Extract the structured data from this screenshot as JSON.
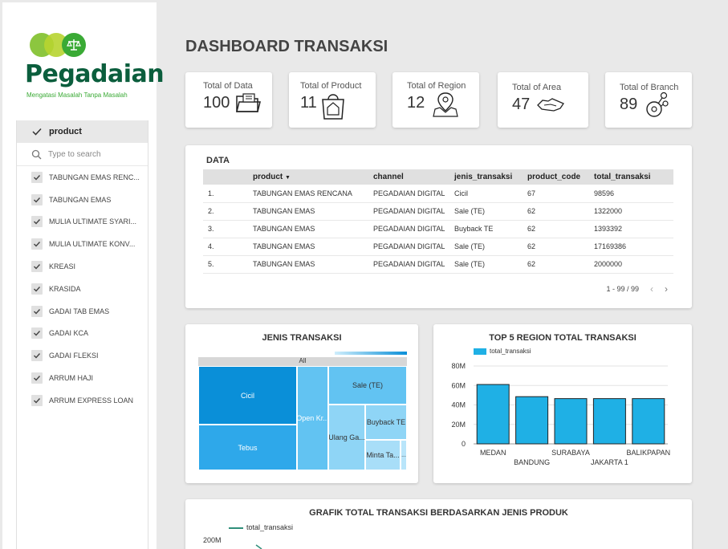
{
  "brand": {
    "name": "Pegadaian",
    "tagline": "Mengatasi Masalah Tanpa Masalah",
    "colors": {
      "dark_green": "#0b5e3d",
      "green": "#3aaa35",
      "light_green": "#8cc63f"
    }
  },
  "filter": {
    "header": "product",
    "search_placeholder": "Type to search",
    "options": [
      "TABUNGAN EMAS RENCANA",
      "TABUNGAN EMAS",
      "MULIA ULTIMATE SYARIAH",
      "MULIA ULTIMATE KONVENSIONAL",
      "KREASI",
      "KRASIDA",
      "GADAI TAB EMAS",
      "GADAI KCA",
      "GADAI FLEKSI",
      "ARRUM HAJI",
      "ARRUM EXPRESS LOAN"
    ],
    "options_display": [
      "TABUNGAN EMAS RENC...",
      "TABUNGAN EMAS",
      "MULIA ULTIMATE SYARI...",
      "MULIA ULTIMATE KONV...",
      "KREASI",
      "KRASIDA",
      "GADAI TAB EMAS",
      "GADAI KCA",
      "GADAI FLEKSI",
      "ARRUM HAJI",
      "ARRUM EXPRESS LOAN"
    ]
  },
  "page_title": "DASHBOARD TRANSAKSI",
  "kpis": [
    {
      "label": "Total of Data",
      "value": "100",
      "icon": "folder-icon"
    },
    {
      "label": "Total of Product",
      "value": "11",
      "icon": "shopping-bag-icon"
    },
    {
      "label": "Total of Region",
      "value": "12",
      "icon": "map-pin-icon"
    },
    {
      "label": "Total of Area",
      "value": "47",
      "icon": "area-map-icon"
    },
    {
      "label": "Total of Branch",
      "value": "89",
      "icon": "branch-icon"
    }
  ],
  "data_table": {
    "title": "DATA",
    "columns": [
      "",
      "product",
      "channel",
      "jenis_transaksi",
      "product_code",
      "total_transaksi"
    ],
    "sort_column": "product",
    "rows": [
      [
        "1.",
        "TABUNGAN EMAS RENCANA",
        "PEGADAIAN DIGITAL",
        "Cicil",
        "67",
        "98596"
      ],
      [
        "2.",
        "TABUNGAN EMAS",
        "PEGADAIAN DIGITAL",
        "Sale (TE)",
        "62",
        "1322000"
      ],
      [
        "3.",
        "TABUNGAN EMAS",
        "PEGADAIAN DIGITAL",
        "Buyback TE",
        "62",
        "1393392"
      ],
      [
        "4.",
        "TABUNGAN EMAS",
        "PEGADAIAN DIGITAL",
        "Sale (TE)",
        "62",
        "17169386"
      ],
      [
        "5.",
        "TABUNGAN EMAS",
        "PEGADAIAN DIGITAL",
        "Sale (TE)",
        "62",
        "2000000"
      ]
    ],
    "pagination": "1 - 99 / 99"
  },
  "treemap": {
    "title": "JENIS TRANSAKSI",
    "root_label": "All",
    "cells": [
      "Cicil",
      "Tebus",
      "Open Kr...",
      "Sale (TE)",
      "Ulang Ga...",
      "Buyback TE",
      "Minta Ta...",
      "..."
    ],
    "colors": {
      "dark": "#0a8fd8",
      "mid": "#2ea8ea",
      "light": "#62c3f2",
      "lighter": "#8fd5f6"
    }
  },
  "chart_data": [
    {
      "type": "bar",
      "title": "TOP 5 REGION TOTAL TRANSAKSI",
      "categories": [
        "MEDAN",
        "BANDUNG",
        "SURABAYA",
        "JAKARTA 1",
        "BALIKPAPAN"
      ],
      "series": [
        {
          "name": "total_transaksi",
          "values": [
            61000000,
            48500000,
            46500000,
            46500000,
            46500000
          ]
        }
      ],
      "ylim": [
        0,
        80000000
      ],
      "yticks": [
        "0",
        "20M",
        "40M",
        "60M",
        "80M"
      ],
      "grid": true,
      "legend": "top-left",
      "color": "#1fb0e5"
    },
    {
      "type": "line",
      "title": "GRAFIK TOTAL TRANSAKSI BERDASARKAN JENIS PRODUK",
      "series": [
        {
          "name": "total_transaksi",
          "values": []
        }
      ],
      "yticks": [
        "200M"
      ],
      "legend": "top-left",
      "color": "#2f8f7a"
    }
  ]
}
